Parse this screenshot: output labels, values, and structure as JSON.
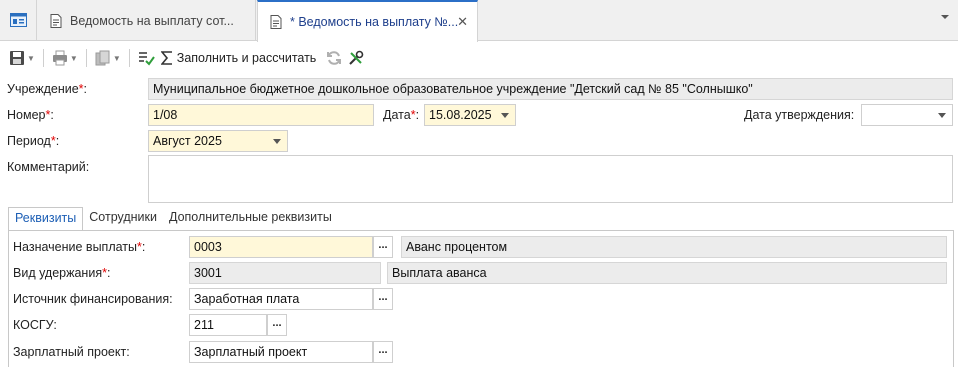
{
  "tabs": {
    "tab1_label": "Ведомость на выплату сот...",
    "tab2_label": "* Ведомость на выплату №...",
    "close_glyph": "✕"
  },
  "toolbar": {
    "fill_label": "Заполнить и рассчитать"
  },
  "form": {
    "institution_label": "Учреждение",
    "institution_value": "Муниципальное бюджетное дошкольное образовательное учреждение \"Детский сад № 85 \"Солнышко\"",
    "number_label": "Номер",
    "number_value": "1/08",
    "date_label": "Дата",
    "date_value": "15.08.2025",
    "approval_date_label": "Дата утверждения:",
    "approval_date_value": "",
    "period_label": "Период",
    "period_value": "Август 2025",
    "comment_label": "Комментарий:",
    "comment_value": ""
  },
  "inner_tabs": [
    "Реквизиты",
    "Сотрудники",
    "Дополнительные реквизиты"
  ],
  "details": {
    "payment_purpose_label": "Назначение выплаты",
    "payment_purpose_code": "0003",
    "payment_purpose_name": "Аванс процентом",
    "deduction_type_label": "Вид удержания",
    "deduction_type_code": "3001",
    "deduction_type_name": "Выплата аванса",
    "funding_source_label": "Источник финансирования:",
    "funding_source_value": "Заработная плата",
    "kosgu_label": "КОСГУ:",
    "kosgu_value": "211",
    "salary_project_label": "Зарплатный проект:",
    "salary_project_value": "Зарплатный проект"
  },
  "symbols": {
    "required_mark": "*",
    "colon": ":",
    "ellipsis": "..."
  },
  "colors": {
    "required": "#e00000",
    "required_field_bg": "#fff8d9",
    "readonly_bg": "#ececec",
    "active_tab_text": "#1d5fb5"
  }
}
